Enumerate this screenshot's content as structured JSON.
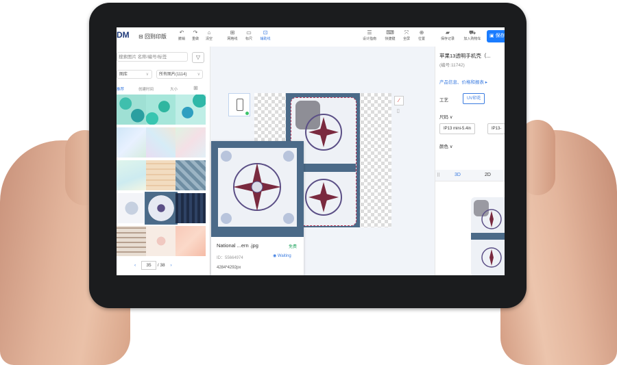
{
  "toolbar": {
    "logo": "DM",
    "back_label": "回到印版",
    "buttons": [
      {
        "label": "撤销",
        "icon": "undo-icon"
      },
      {
        "label": "重做",
        "icon": "redo-icon"
      },
      {
        "label": "清空",
        "icon": "trash-icon"
      },
      {
        "label": "网格线",
        "icon": "grid-icon"
      },
      {
        "label": "标尺",
        "icon": "ruler-icon"
      },
      {
        "label": "辅助线",
        "icon": "guide-icon"
      },
      {
        "label": "设计指南",
        "icon": "guide-book-icon"
      },
      {
        "label": "快捷键",
        "icon": "keyboard-icon"
      },
      {
        "label": "全屏",
        "icon": "fullscreen-icon"
      },
      {
        "label": "位置",
        "icon": "position-icon"
      },
      {
        "label": "保存记录",
        "icon": "folder-icon"
      },
      {
        "label": "加入购物车",
        "icon": "cart-icon"
      }
    ],
    "save_label": "保存"
  },
  "left_panel": {
    "search_placeholder": "搜索图片 名称/编号/标签",
    "library_select": "图库",
    "category_select": "所有图片(1114)",
    "sort_options": [
      "推荐",
      "创建时间",
      "大小"
    ],
    "page_current": "35",
    "page_total": "/ 38"
  },
  "preview_card": {
    "filename": "National ...ern .jpg",
    "tag": "免费",
    "id_text": "ID：55664974",
    "status": "Waiting",
    "size": "4284*4292px"
  },
  "right_panel": {
    "product_title": "苹果13透明手机壳（...",
    "product_code": "(编号:11742)",
    "info_link": "产品信息、价格和报表 ▸",
    "craft_label": "工艺",
    "craft_option": "UV印花",
    "size_label": "尺码 ∨",
    "size_options": [
      "IP13 mini-5.4in",
      "IP13-"
    ],
    "color_label": "颜色 ∨",
    "view_tabs": [
      "3D",
      "2D"
    ]
  },
  "colors": {
    "accent": "#1a7cff",
    "frame": "#4b6a88",
    "tablet": "#1b1c1e"
  }
}
